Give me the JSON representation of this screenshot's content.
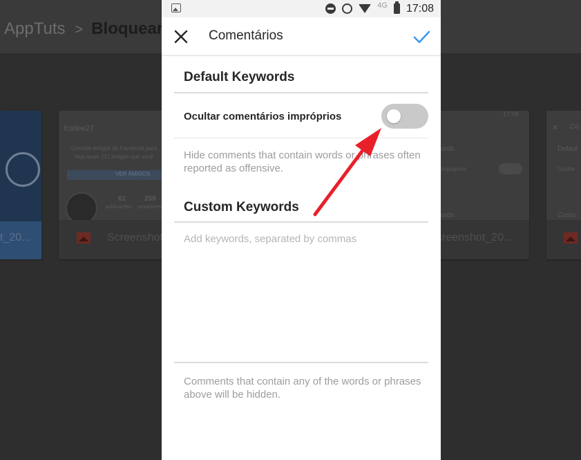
{
  "background": {
    "breadcrumb": {
      "root": "AppTuts",
      "separator": ">",
      "current": "Bloquear"
    },
    "cards": {
      "left_caption": "t_20...",
      "shot1": {
        "username": "fcallee27",
        "banner_line1": "Convide amigos do Facebook para",
        "banner_line2": "Veja quais 117 amigos que você",
        "button": "VER AMIGOS",
        "stat1": "61",
        "stat2": "259",
        "stat1_label": "publicações",
        "stat2_label": "seguidores",
        "caption": "Screenshot"
      },
      "shot2": {
        "time": "17:08",
        "label_a": "ords",
        "label_b": "impróprios",
        "label_c": "ords",
        "caption": "creenshot_20..."
      },
      "shot3": {
        "title": "Co",
        "label_a": "Defaul",
        "label_b": "Ocultar",
        "label_c": "Custo"
      }
    }
  },
  "statusbar": {
    "network": "4G",
    "time": "17:08"
  },
  "appbar": {
    "title": "Comentários",
    "close_icon": "close-icon",
    "confirm_icon": "check-icon"
  },
  "default_keywords": {
    "heading": "Default Keywords",
    "toggle_label": "Ocultar comentários impróprios",
    "toggle_on": false,
    "help": "Hide comments that contain words or phrases often reported as offensive."
  },
  "custom_keywords": {
    "heading": "Custom Keywords",
    "input_value": "",
    "input_placeholder": "Add keywords, separated by commas",
    "help": "Comments that contain any of the words or phrases above will be hidden."
  },
  "colors": {
    "accent": "#3897f0",
    "annotation_arrow": "#e8202a",
    "toggle_off": "#c9c9c9"
  }
}
